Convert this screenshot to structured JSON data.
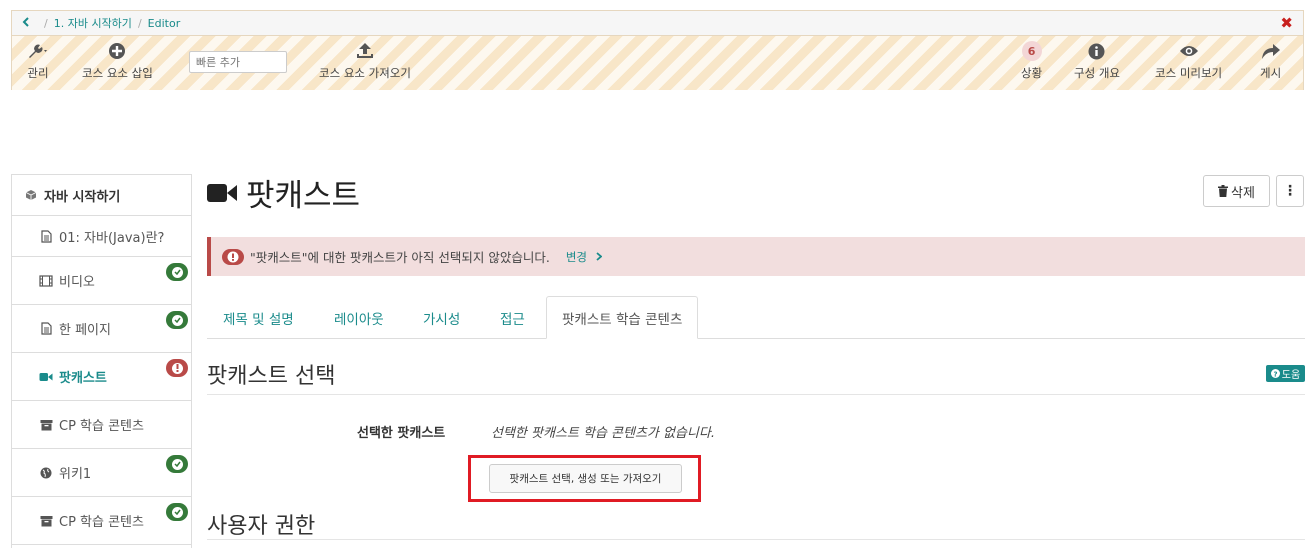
{
  "breadcrumb": {
    "course": "1. 자바 시작하기",
    "current": "Editor"
  },
  "toolbar": {
    "manage": "관리",
    "insert_element": "코스 요소 삽입",
    "quick_add_placeholder": "빠른 추가",
    "import_element": "코스 요소 가져오기",
    "status_count": "6",
    "status": "상황",
    "overview": "구성 개요",
    "preview": "코스 미리보기",
    "publish": "게시"
  },
  "sidebar": {
    "root": "자바 시작하기",
    "items": [
      {
        "label": "01: 자바(Java)란?",
        "icon": "file-icon",
        "badge": "none"
      },
      {
        "label": "비디오",
        "icon": "film-icon",
        "badge": "ok"
      },
      {
        "label": "한 페이지",
        "icon": "file-icon",
        "badge": "ok"
      },
      {
        "label": "팟캐스트",
        "icon": "video-camera-icon",
        "badge": "error"
      },
      {
        "label": "CP 학습 콘텐츠",
        "icon": "archive-icon",
        "badge": "none"
      },
      {
        "label": "위키1",
        "icon": "globe-icon",
        "badge": "ok"
      },
      {
        "label": "CP 학습 콘텐츠",
        "icon": "archive-icon",
        "badge": "ok"
      }
    ]
  },
  "main": {
    "title": "팟캐스트",
    "delete_label": "삭제",
    "more_label": "⋮",
    "alert_text": "\"팟캐스트\"에 대한 팟캐스트가 아직 선택되지 않았습니다.",
    "alert_link": "변경",
    "tabs": [
      "제목 및 설명",
      "레이아웃",
      "가시성",
      "접근",
      "팟캐스트 학습 콘텐츠"
    ],
    "section_select": "팟캐스트 선택",
    "help_label": "도움",
    "selected_label": "선택한 팟캐스트",
    "selected_value": "선택한 팟캐스트 학습 콘텐츠가 없습니다.",
    "select_button": "팟캐스트 선택, 생성 또는 가져오기",
    "section_rights": "사용자 권한"
  },
  "colors": {
    "accent": "#1a8b8b",
    "error": "#b94a48",
    "success": "#357a3a",
    "highlight": "#e01b24"
  }
}
